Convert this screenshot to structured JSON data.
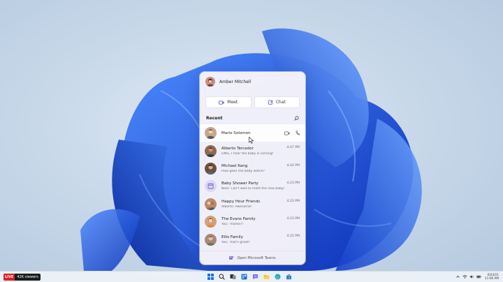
{
  "flyout": {
    "user_name": "Amber Mitchell",
    "meet_label": "Meet",
    "chat_label": "Chat",
    "recent_label": "Recent",
    "footer_label": "Open Microsoft Teams",
    "contacts": [
      {
        "name": "Mario Solomon",
        "preview": "",
        "time": "",
        "avatar_color": "#c7a48a",
        "icon": "person-avatar"
      },
      {
        "name": "Alberto Tercedor",
        "preview": "OMG, I hear the baby is coming!",
        "time": "4:47 PM",
        "avatar_color": "#8c6a52",
        "icon": "person-avatar"
      },
      {
        "name": "Michael Kang",
        "preview": "How goes the baby watch?",
        "time": "4:42 PM",
        "avatar_color": "#6b4f3d",
        "icon": "person-avatar"
      },
      {
        "name": "Baby Shower Party",
        "preview": "Noel: Can't wait to meet the new baby!",
        "time": "4:23 PM",
        "avatar_color": "#ddd6f4",
        "icon": "calendar-group-icon"
      },
      {
        "name": "Happy Hour Friends",
        "preview": "Alberto: Awesome!",
        "time": "4:23 PM",
        "avatar_color": "#b98b6a",
        "icon": "person-avatar"
      },
      {
        "name": "The Evans Family",
        "preview": "You: Thanks!!",
        "time": "4:23 PM",
        "avatar_color": "#d2a079",
        "icon": "person-avatar"
      },
      {
        "name": "Ellis Family",
        "preview": "You: That's great!",
        "time": "4:22 PM",
        "avatar_color": "#a8887a",
        "icon": "person-avatar"
      }
    ]
  },
  "taskbar": {
    "live_label": "LIVE",
    "viewers_label": "42K viewers",
    "clock_time": "6/24/21",
    "clock_date": "11:00 AM",
    "icons": [
      "windows-start-icon",
      "search-icon",
      "task-view-icon",
      "widgets-icon",
      "teams-chat-icon",
      "file-explorer-icon",
      "edge-icon",
      "store-icon"
    ]
  },
  "colors": {
    "accent": "#5b5fc7",
    "wallpaper_blue": "#1f5fe0"
  }
}
